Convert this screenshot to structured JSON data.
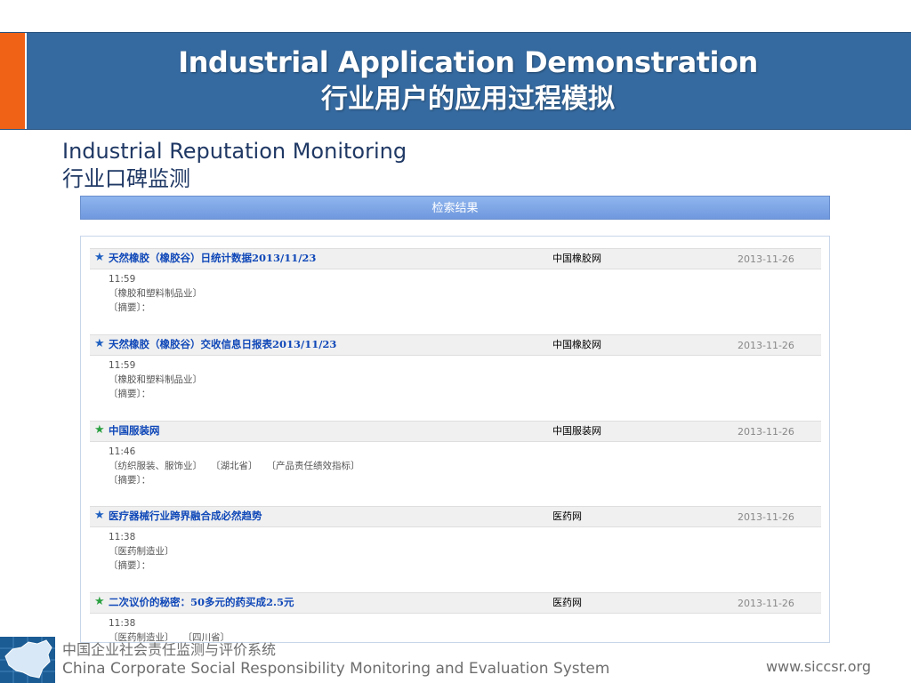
{
  "header": {
    "title": "Industrial Application Demonstration",
    "subtitle_cn": "行业用户的应用过程模拟"
  },
  "section": {
    "title_en": "Industrial Reputation Monitoring",
    "title_cn": "行业口碑监测"
  },
  "results": {
    "header": "检索结果",
    "items": [
      {
        "title": "天然橡胶（橡胶谷）日统计数据2013/11/23",
        "source": "中国橡胶网",
        "date": "2013-11-26",
        "time": "11:59",
        "tags": "〔橡胶和塑料制品业〕",
        "summary": "〔摘要〕：",
        "star_color": "blue"
      },
      {
        "title": "天然橡胶（橡胶谷）交收信息日报表2013/11/23",
        "source": "中国橡胶网",
        "date": "2013-11-26",
        "time": "11:59",
        "tags": "〔橡胶和塑料制品业〕",
        "summary": "〔摘要〕：",
        "star_color": "blue"
      },
      {
        "title": "中国服装网",
        "source": "中国服装网",
        "date": "2013-11-26",
        "time": "11:46",
        "tags": "〔纺织服装、服饰业〕   〔湖北省〕   〔产品责任绩效指标〕",
        "summary": "〔摘要〕：",
        "star_color": "green"
      },
      {
        "title": "医疗器械行业跨界融合成必然趋势",
        "source": "医药网",
        "date": "2013-11-26",
        "time": "11:38",
        "tags": "〔医药制造业〕",
        "summary": "〔摘要〕：",
        "star_color": "blue"
      },
      {
        "title": "二次议价的秘密：50多元的药买成2.5元",
        "source": "医药网",
        "date": "2013-11-26",
        "time": "11:38",
        "tags": "〔医药制造业〕   〔四川省〕",
        "summary": "",
        "star_color": "green"
      }
    ]
  },
  "footer": {
    "org_cn": "中国企业社会责任监测与评价系统",
    "org_en": "China Corporate Social Responsibility Monitoring and Evaluation System",
    "url": "www.siccsr.org"
  },
  "colors": {
    "banner": "#356aa0",
    "accent": "#f06216",
    "link": "#1048b8"
  }
}
